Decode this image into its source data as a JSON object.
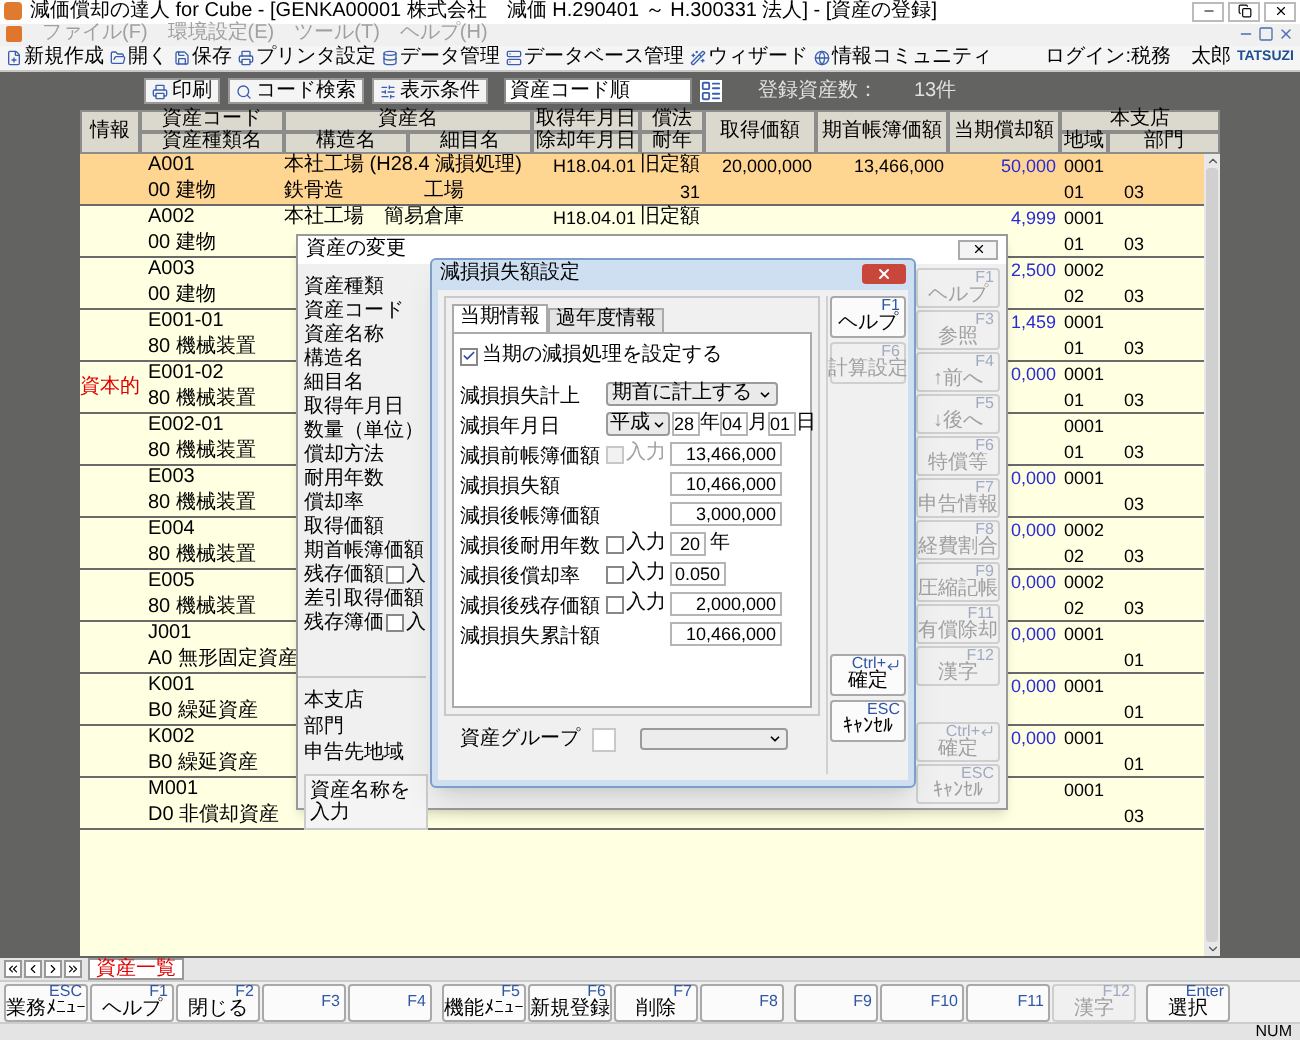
{
  "window": {
    "title": "減価償却の達人 for Cube - [GENKA00001 株式会社　減価 H.290401 ～ H.300331 法人] - [資産の登録]"
  },
  "menu": [
    {
      "label": "ファイル(F)",
      "disabled": true
    },
    {
      "label": "環境設定(E)",
      "disabled": true
    },
    {
      "label": "ツール(T)",
      "disabled": true
    },
    {
      "label": "ヘルプ(H)",
      "disabled": true
    }
  ],
  "toolbar": [
    "新規作成",
    "開く",
    "保存",
    "プリンタ設定",
    "データ管理",
    "データベース管理",
    "ウィザード",
    "情報コミュニティ"
  ],
  "login": "ログイン:税務　太郎",
  "logo": "TATSUZI",
  "list_toolbar": {
    "buttons": [
      "印刷",
      "コード検索",
      "表示条件"
    ],
    "sort": {
      "value": "資産コード順"
    },
    "count_label": "登録資産数：",
    "count": "13件"
  },
  "table": {
    "header": {
      "info": "情報",
      "code": "資産コード",
      "kind": "資産種類名",
      "name": "資産名",
      "structure": "構造名",
      "detail": "細目名",
      "acquired": "取得年月日",
      "retired": "除却年月日",
      "method": "償法",
      "life": "耐年",
      "cost": "取得価額",
      "opening": "期首帳簿価額",
      "depreciation": "当期償却額",
      "branch": "本支店",
      "region": "地域",
      "dept": "部門"
    },
    "rows": [
      {
        "code": "A001",
        "kind": "00 建物",
        "name": "本社工場 (H28.4 減損処理)",
        "structure": "鉄骨造",
        "detail": "工場",
        "acquired": "H18.04.01",
        "method": "旧定額",
        "life": "31",
        "cost": "20,000,000",
        "opening": "13,466,000",
        "depreciation": "50,000",
        "branch": "0001",
        "region": "01",
        "dept": "03",
        "selected": true
      },
      {
        "code": "A002",
        "kind": "00 建物",
        "name": "本社工場　簡易倉庫",
        "acquired": "H18.04.01",
        "method": "旧定額",
        "depreciation": "4,999",
        "branch": "0001",
        "region": "01",
        "dept": "03",
        "selected": false
      },
      {
        "code": "A003",
        "kind": "00 建物",
        "depreciation": "2,500",
        "branch": "0002",
        "region": "02",
        "dept": "03",
        "selected": false
      },
      {
        "code": "E001-01",
        "kind": "80 機械装置",
        "depreciation": "1,459",
        "branch": "0001",
        "region": "01",
        "dept": "03",
        "selected": false
      },
      {
        "info": "資本的",
        "code": "E001-02",
        "kind": "80 機械装置",
        "depreciation": "0,000",
        "branch": "0001",
        "region": "01",
        "dept": "03",
        "selected": false
      },
      {
        "code": "E002-01",
        "kind": "80 機械装置",
        "branch": "0001",
        "region": "01",
        "dept": "03",
        "selected": false
      },
      {
        "code": "E003",
        "kind": "80 機械装置",
        "depreciation": "0,000",
        "branch": "0001",
        "dept": "03",
        "selected": false
      },
      {
        "code": "E004",
        "kind": "80 機械装置",
        "depreciation": "0,000",
        "branch": "0002",
        "region": "02",
        "dept": "03",
        "selected": false
      },
      {
        "code": "E005",
        "kind": "80 機械装置",
        "depreciation": "0,000",
        "branch": "0002",
        "region": "02",
        "dept": "03",
        "selected": false
      },
      {
        "code": "J001",
        "kind": "A0 無形固定資産",
        "depreciation": "0,000",
        "branch": "0001",
        "dept": "01",
        "selected": false
      },
      {
        "code": "K001",
        "kind": "B0 繰延資産",
        "depreciation": "0,000",
        "branch": "0001",
        "dept": "01",
        "selected": false
      },
      {
        "code": "K002",
        "kind": "B0 繰延資産",
        "depreciation": "0,000",
        "branch": "0001",
        "dept": "01",
        "selected": false
      },
      {
        "code": "M001",
        "kind": "D0 非償却資産",
        "branch": "0001",
        "dept": "03",
        "selected": false
      }
    ]
  },
  "asset_dialog": {
    "title": "資産の変更",
    "fields": [
      {
        "label": "資産種類"
      },
      {
        "label": "資産コード"
      },
      {
        "label": "資産名称"
      },
      {
        "label": "構造名"
      },
      {
        "label": "細目名"
      },
      {
        "label": "取得年月日"
      },
      {
        "label": "数量（単位）"
      },
      {
        "label": "償却方法"
      },
      {
        "label": "耐用年数"
      },
      {
        "label": "償却率"
      },
      {
        "label": "取得価額"
      },
      {
        "label": "期首帳簿価額"
      },
      {
        "label": "残存価額",
        "checkbox": {
          "label": "入",
          "checked": false
        }
      },
      {
        "label": "差引取得価額"
      },
      {
        "label": "残存簿価",
        "checkbox": {
          "label": "入",
          "checked": false
        }
      }
    ],
    "lower_fields": [
      {
        "label": "本支店"
      },
      {
        "label": "部門"
      },
      {
        "label": "申告先地域"
      }
    ],
    "name_box": "資産名称を入力",
    "buttons": [
      {
        "key": "F1",
        "label": "ヘルプ",
        "disabled": true
      },
      {
        "key": "F3",
        "label": "参照",
        "disabled": true
      },
      {
        "key": "F4",
        "label": "↑前へ",
        "disabled": true
      },
      {
        "key": "F5",
        "label": "↓後へ",
        "disabled": true
      },
      {
        "key": "F6",
        "label": "特償等",
        "disabled": true
      },
      {
        "key": "F7",
        "label": "申告情報",
        "disabled": true
      },
      {
        "key": "F8",
        "label": "経費割合",
        "disabled": true
      },
      {
        "key": "F9",
        "label": "圧縮記帳",
        "disabled": true
      },
      {
        "key": "F11",
        "label": "有償除却",
        "disabled": true
      },
      {
        "key": "F12",
        "label": "漢字",
        "disabled": true
      }
    ],
    "confirm_buttons": [
      {
        "key": "Ctrl+",
        "label": "確定",
        "disabled": true,
        "enter": true
      },
      {
        "key": "ESC",
        "label": "ｷｬﾝｾﾙ",
        "disabled": true,
        "enter": false
      }
    ]
  },
  "impairment_dialog": {
    "title": "減損損失額設定",
    "tabs": [
      {
        "label": "当期情報",
        "selected": true
      },
      {
        "label": "過年度情報",
        "selected": false
      }
    ],
    "enable": {
      "label": "当期の減損処理を設定する",
      "checked": true
    },
    "rows": [
      {
        "kind": "select",
        "label": "減損損失計上",
        "value": "期首に計上する"
      },
      {
        "kind": "date",
        "label": "減損年月日",
        "era": "平成",
        "year": "28",
        "year_unit": "年",
        "month": "04",
        "month_unit": "月",
        "day": "01",
        "day_unit": "日"
      },
      {
        "kind": "amount",
        "label": "減損前帳簿価額",
        "input": {
          "label": "入力",
          "checked": false,
          "disabled": true
        },
        "value": "13,466,000"
      },
      {
        "kind": "amount",
        "label": "減損損失額",
        "value": "10,466,000"
      },
      {
        "kind": "amount",
        "label": "減損後帳簿価額",
        "value": "3,000,000"
      },
      {
        "kind": "short",
        "label": "減損後耐用年数",
        "input": {
          "label": "入力",
          "checked": false,
          "disabled": false
        },
        "value": "20",
        "unit": "年"
      },
      {
        "kind": "short",
        "label": "減損後償却率",
        "input": {
          "label": "入力",
          "checked": false,
          "disabled": false
        },
        "value": "0.050"
      },
      {
        "kind": "amount",
        "label": "減損後残存価額",
        "input": {
          "label": "入力",
          "checked": false,
          "disabled": false
        },
        "value": "2,000,000"
      },
      {
        "kind": "amount",
        "label": "減損損失累計額",
        "value": "10,466,000"
      }
    ],
    "group_label": "資産グループ",
    "buttons": [
      {
        "key": "F1",
        "label": "ヘルプ",
        "disabled": false,
        "enter": false
      },
      {
        "key": "F6",
        "label": "計算設定",
        "disabled": true,
        "enter": false
      }
    ],
    "confirm_buttons": [
      {
        "key": "Ctrl+",
        "label": "確定",
        "disabled": false,
        "enter": true
      },
      {
        "key": "ESC",
        "label": "ｷｬﾝｾﾙ",
        "disabled": false,
        "enter": false
      }
    ]
  },
  "sheet_tabs": [
    {
      "label": "資産一覧",
      "selected": true
    }
  ],
  "function_keys": [
    {
      "key": "ESC",
      "label": "業務ﾒﾆｭｰ",
      "disabled": false
    },
    {
      "key": "F1",
      "label": "ヘルプ",
      "disabled": false
    },
    {
      "key": "F2",
      "label": "閉じる",
      "disabled": false
    },
    {
      "key": "F3",
      "disabled": false
    },
    {
      "key": "F4",
      "disabled": false
    },
    {
      "key": "F5",
      "label": "機能ﾒﾆｭｰ",
      "disabled": false
    },
    {
      "key": "F6",
      "label": "新規登録",
      "disabled": false
    },
    {
      "key": "F7",
      "label": "削除",
      "disabled": false
    },
    {
      "key": "F8",
      "disabled": false
    },
    {
      "key": "F9",
      "disabled": false
    },
    {
      "key": "F10",
      "disabled": false
    },
    {
      "key": "F11",
      "disabled": false
    },
    {
      "key": "F12",
      "label": "漢字",
      "disabled": true
    },
    {
      "key": "Enter",
      "label": "選択",
      "disabled": false
    }
  ],
  "status_bar": {
    "num": "NUM"
  }
}
